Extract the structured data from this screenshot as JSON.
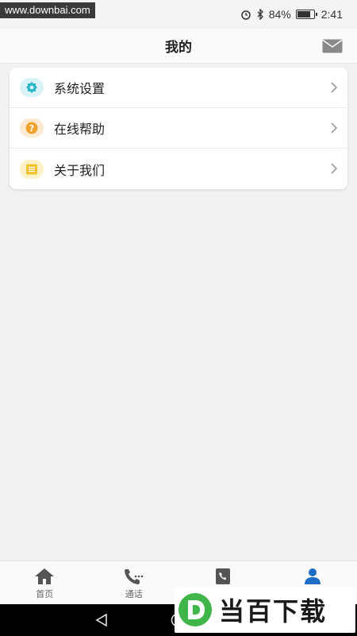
{
  "watermark_top": "www.downbai.com",
  "status_bar": {
    "battery": "84%",
    "battery_level": 0.84,
    "time": "2:41"
  },
  "header": {
    "title": "我的",
    "mail_icon": "mail-icon"
  },
  "menu": [
    {
      "label": "系统设置",
      "icon": "gear-icon",
      "icon_color": "#2bb5c9",
      "icon_bg": "#d9f3f6"
    },
    {
      "label": "在线帮助",
      "icon": "help-icon",
      "icon_color": "#f0a22e",
      "icon_bg": "#fcebd2"
    },
    {
      "label": "关于我们",
      "icon": "list-icon",
      "icon_color": "#f2c230",
      "icon_bg": "#fdf2c7"
    }
  ],
  "tabs": [
    {
      "label": "首页",
      "icon": "home-icon",
      "active": false
    },
    {
      "label": "通话",
      "icon": "phone-icon",
      "active": false
    },
    {
      "label": "",
      "icon": "contacts-icon",
      "active": false
    },
    {
      "label": "",
      "icon": "person-icon",
      "active": true
    }
  ],
  "colors": {
    "active_tab": "#1f6dc6",
    "inactive_tab": "#555555"
  },
  "logo_watermark": "当百下载"
}
